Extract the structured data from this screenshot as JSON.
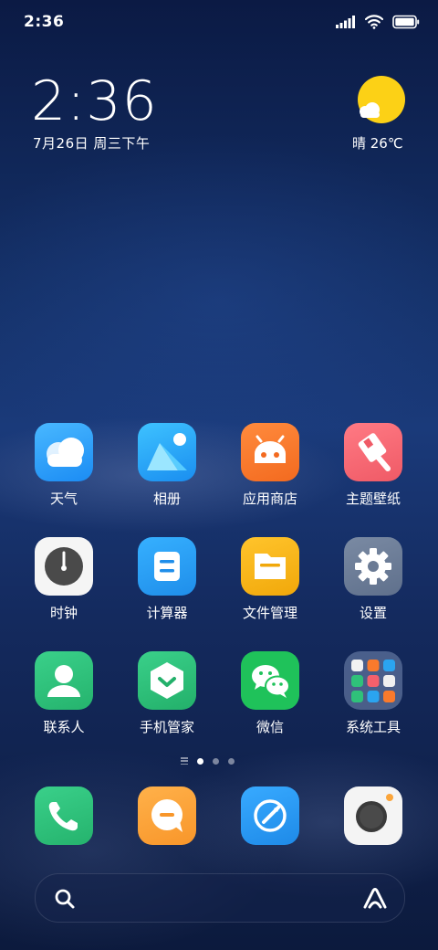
{
  "status_bar": {
    "time": "2:36",
    "icons": [
      "signal-icon",
      "wifi-icon",
      "battery-icon"
    ]
  },
  "clock_widget": {
    "time": "2:36",
    "date": "7月26日 周三下午"
  },
  "weather_widget": {
    "icon": "sun-with-cloud-icon",
    "text": "晴 26℃"
  },
  "apps": [
    {
      "label": "天气",
      "icon": "weather-cloud-icon",
      "color": "#2f9bfa"
    },
    {
      "label": "相册",
      "icon": "gallery-icon",
      "color": "#25a8f5"
    },
    {
      "label": "应用商店",
      "icon": "android-icon",
      "color": "#fa7a2c"
    },
    {
      "label": "主题壁纸",
      "icon": "paint-brush-icon",
      "color": "#f56c75"
    },
    {
      "label": "时钟",
      "icon": "clock-icon",
      "color": "#f4f4f4"
    },
    {
      "label": "计算器",
      "icon": "calculator-icon",
      "color": "#2ba4f0"
    },
    {
      "label": "文件管理",
      "icon": "folder-icon",
      "color": "#f7b419"
    },
    {
      "label": "设置",
      "icon": "gear-icon",
      "color": "#6e7f97"
    },
    {
      "label": "联系人",
      "icon": "person-icon",
      "color": "#2fc17a"
    },
    {
      "label": "手机管家",
      "icon": "shield-icon",
      "color": "#2fc17a"
    },
    {
      "label": "微信",
      "icon": "wechat-icon",
      "color": "#22c55e"
    },
    {
      "label": "系统工具",
      "icon": "folder-grid-icon",
      "color": "#5a6f96"
    }
  ],
  "page_indicator": {
    "pages": 3,
    "active": 0
  },
  "dock": [
    {
      "icon": "phone-icon",
      "color": "#2fc17a"
    },
    {
      "icon": "message-icon",
      "color": "#fba53a"
    },
    {
      "icon": "browser-compass-icon",
      "color": "#2a9ef4"
    },
    {
      "icon": "camera-icon",
      "color": "#f3f3f3"
    }
  ],
  "search_bar": {
    "left_icon": "search-icon",
    "right_icon": "assistant-icon"
  }
}
